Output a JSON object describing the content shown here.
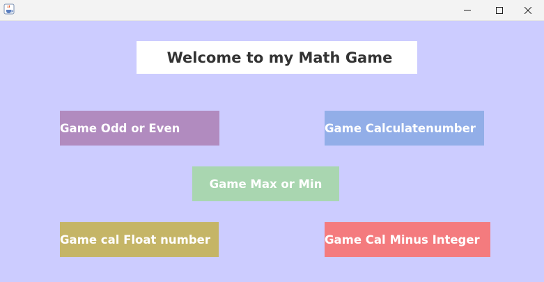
{
  "window": {
    "icon": "java-cup-icon",
    "controls": {
      "minimize": "minimize-icon",
      "maximize": "maximize-icon",
      "close": "close-icon"
    }
  },
  "main": {
    "title": "Welcome to my Math Game",
    "buttons": {
      "odd_even": "Game Odd or Even",
      "calculate_number": "Game Calculatenumber",
      "max_min": "Game Max or Min",
      "float_number": "Game cal Float number",
      "minus_integer": "Game Cal Minus Integer"
    }
  },
  "colors": {
    "background": "#ccccff",
    "odd_even": "#b18bbf",
    "calculate_number": "#92aee8",
    "max_min": "#a9d6b0",
    "float_number": "#c5b566",
    "minus_integer": "#f47b7e"
  }
}
